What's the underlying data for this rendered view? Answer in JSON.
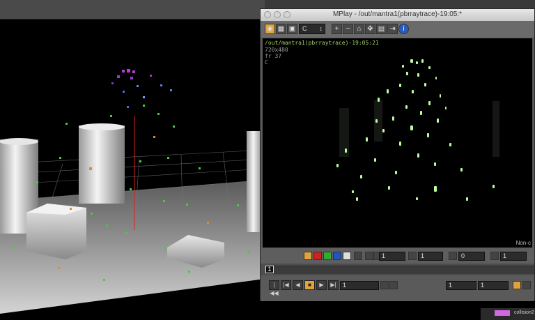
{
  "mplay": {
    "title": "MPlay - /out/mantra1(pbrraytrace)-19:05:*",
    "channel": "C",
    "overlay_path": "/out/mantra1(pbrraytrace)-19:05:21",
    "overlay_res": "720x480",
    "overlay_frame": "fr 37",
    "overlay_channel": "C",
    "corner_text": "Non-c",
    "ctrl_values": {
      "a": "1",
      "b": "1",
      "c": "0",
      "d": "1"
    },
    "timeline_frame": "1",
    "play_frame": "1",
    "range_start": "1",
    "range_end": "1"
  },
  "status": {
    "label": "collision2"
  },
  "colors": {
    "accent_green": "#9fcf6a",
    "active_orange": "#e0a23a",
    "playhead": "#ffffff"
  }
}
